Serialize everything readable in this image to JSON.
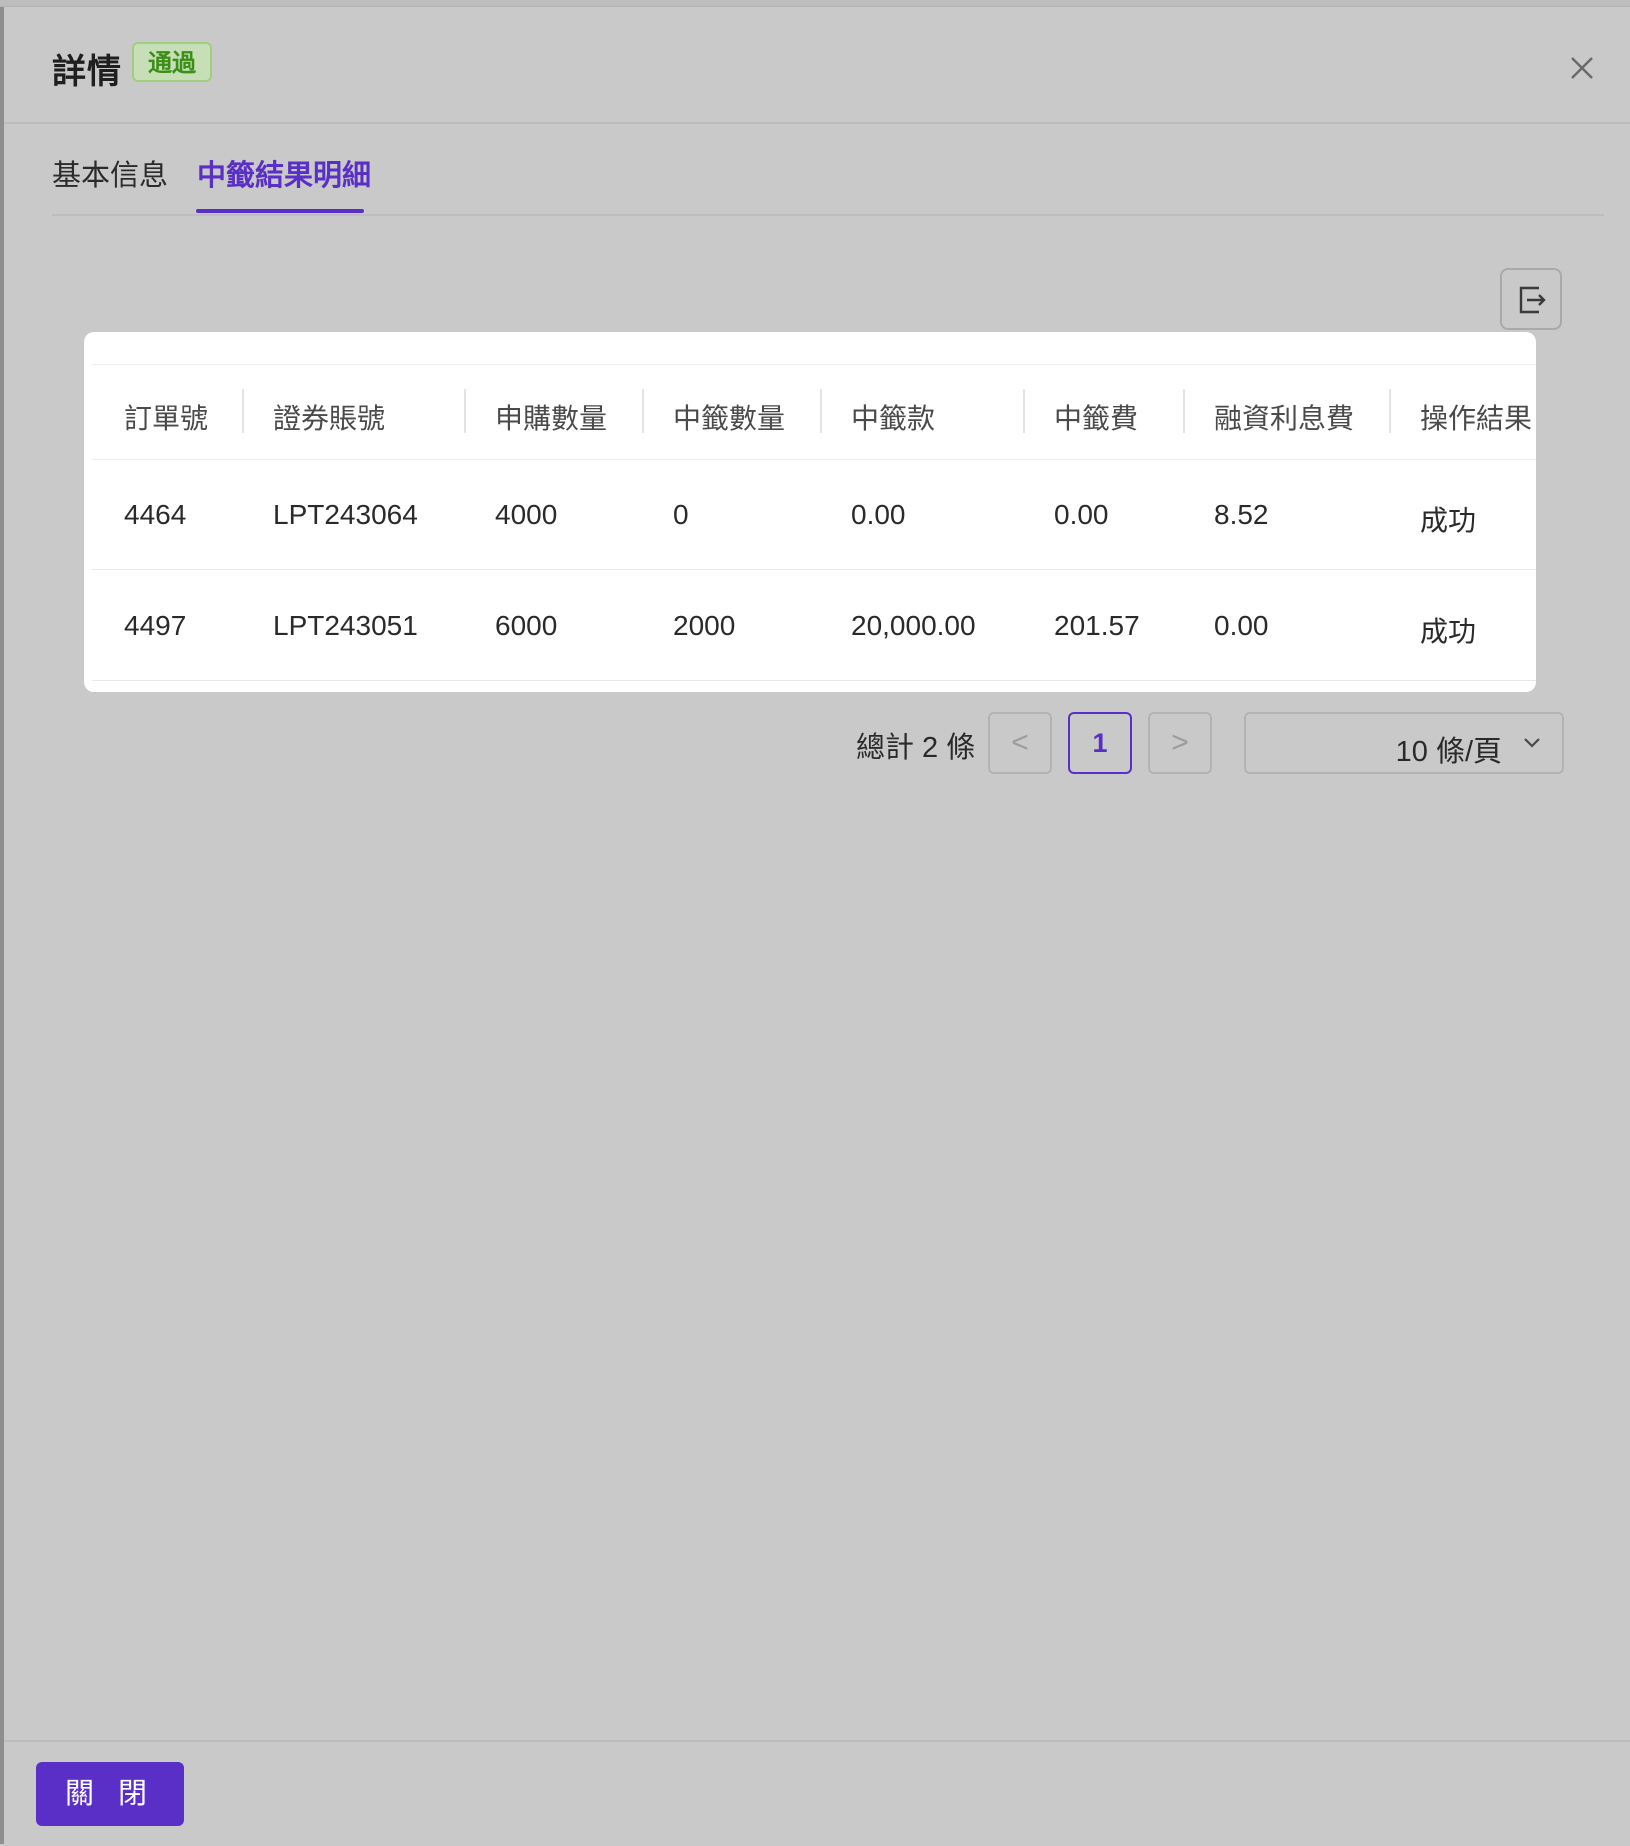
{
  "dialog": {
    "title": "詳情",
    "status_badge": "通過",
    "close_icon": "close-icon"
  },
  "tabs": [
    {
      "label": "基本信息",
      "active": false
    },
    {
      "label": "中籤結果明細",
      "active": true
    }
  ],
  "toolbar": {
    "export_icon": "export-icon"
  },
  "table": {
    "columns": [
      "訂單號",
      "證券賬號",
      "申購數量",
      "中籤數量",
      "中籤款",
      "中籤費",
      "融資利息費",
      "操作結果"
    ],
    "rows": [
      [
        "4464",
        "LPT243064",
        "4000",
        "0",
        "0.00",
        "0.00",
        "8.52",
        "成功"
      ],
      [
        "4497",
        "LPT243051",
        "6000",
        "2000",
        "20,000.00",
        "201.57",
        "0.00",
        "成功"
      ]
    ]
  },
  "pagination": {
    "total_text": "總計 2 條",
    "prev_symbol": "<",
    "current_page": "1",
    "next_symbol": ">",
    "page_size": "10 條/頁"
  },
  "footer": {
    "close_label": "關 閉"
  },
  "colors": {
    "accent": "#5a2fc8",
    "success": "#3b8f16",
    "overlay": "#c9c9c9"
  }
}
